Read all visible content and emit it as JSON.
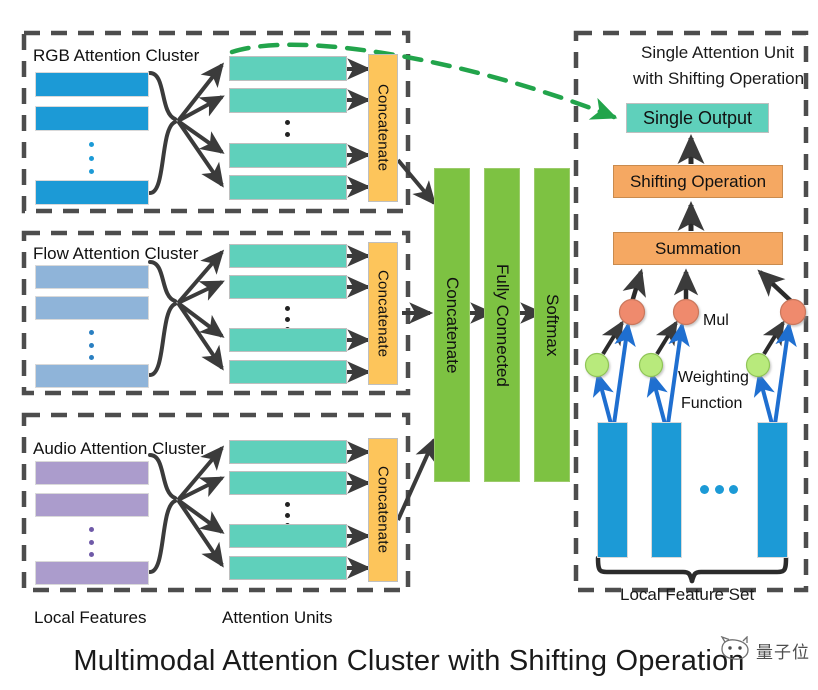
{
  "figure": {
    "caption": "Multimodal Attention Cluster with Shifting Operation",
    "watermark_text": "量子位",
    "watermark_logo": "cat-face-logo"
  },
  "colors": {
    "rgb_feature": "#1c9ad6",
    "flow_feature": "#8fb4d9",
    "audio_feature": "#ab9ccc",
    "attention_unit": "#5fd0bb",
    "concatenate": "#fdc55b",
    "green_stage": "#7dc242",
    "orange_op": "#f5a862",
    "mul_node": "#ef8a6d",
    "weight_node": "#b8ea7c",
    "shift_arrow": "#22a44b",
    "weight_arrow": "#1f6fd0",
    "dashed_border": "#4d4d4d",
    "arrow": "#3b3b3b"
  },
  "left_panel": {
    "clusters": [
      {
        "title": "RGB Attention Cluster",
        "feature_color": "#1c9ad6",
        "concatenate_label": "Concatenate",
        "feature_count_visible": 3,
        "attention_unit_count_visible": 4
      },
      {
        "title": "Flow Attention Cluster",
        "feature_color": "#8fb4d9",
        "concatenate_label": "Concatenate",
        "feature_count_visible": 3,
        "attention_unit_count_visible": 4
      },
      {
        "title": "Audio Attention Cluster",
        "feature_color": "#ab9ccc",
        "concatenate_label": "Concatenate",
        "feature_count_visible": 3,
        "attention_unit_count_visible": 4
      }
    ],
    "axis_labels": {
      "features": "Local Features",
      "units": "Attention Units"
    }
  },
  "middle_panel": {
    "stages": [
      {
        "label": "Concatenate"
      },
      {
        "label": "Fully Connected"
      },
      {
        "label": "Softmax"
      }
    ]
  },
  "right_panel": {
    "title_line1": "Single Attention Unit",
    "title_line2": "with Shifting Operation",
    "single_output": "Single Output",
    "operations": [
      {
        "label": "Shifting Operation"
      },
      {
        "label": "Summation"
      }
    ],
    "node_labels": {
      "mul": "Mul",
      "weighting_line1": "Weighting",
      "weighting_line2": "Function"
    },
    "feature_set_label": "Local Feature Set",
    "mul_node_count": 3,
    "weight_node_count": 3,
    "local_feature_bar_count": 3
  }
}
